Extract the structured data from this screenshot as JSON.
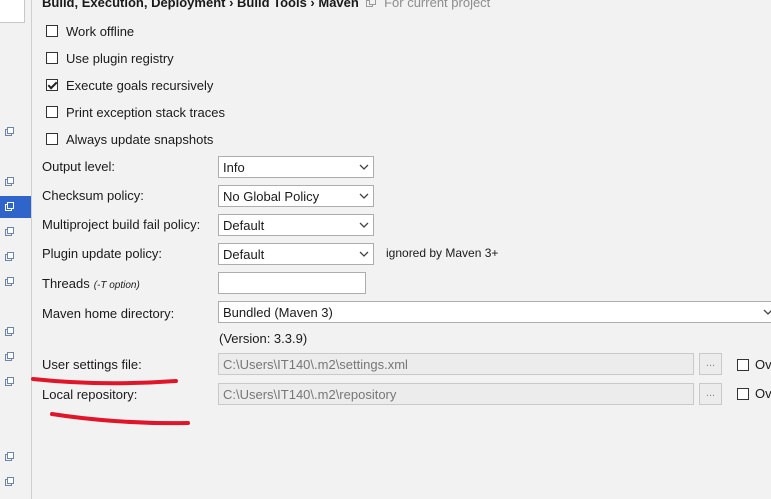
{
  "breadcrumb": {
    "path": "Build, Execution, Deployment › Build Tools › Maven",
    "scope": "For current project"
  },
  "checkboxes": [
    {
      "label": "Work offline",
      "checked": false
    },
    {
      "label": "Use plugin registry",
      "checked": false
    },
    {
      "label": "Execute goals recursively",
      "checked": true
    },
    {
      "label": "Print exception stack traces",
      "checked": false
    },
    {
      "label": "Always update snapshots",
      "checked": false
    }
  ],
  "fields": {
    "output_level": {
      "label": "Output level:",
      "value": "Info"
    },
    "checksum_policy": {
      "label": "Checksum policy:",
      "value": "No Global Policy"
    },
    "multiproject_fail_policy": {
      "label": "Multiproject build fail policy:",
      "value": "Default"
    },
    "plugin_update_policy": {
      "label": "Plugin update policy:",
      "value": "Default",
      "note": "ignored by Maven 3+"
    },
    "threads": {
      "label": "Threads",
      "hint": "(-T option)",
      "value": ""
    },
    "maven_home": {
      "label": "Maven home directory:",
      "value": "Bundled (Maven 3)",
      "version": "(Version: 3.3.9)"
    },
    "user_settings": {
      "label": "User settings file:",
      "value": "C:\\Users\\IT140\\.m2\\settings.xml",
      "browse": "...",
      "override": "Ov"
    },
    "local_repository": {
      "label": "Local repository:",
      "value": "C:\\Users\\IT140\\.m2\\repository",
      "browse": "...",
      "override": "Ov"
    }
  },
  "colors": {
    "background": "#f2f2f2",
    "selection": "#2f65ca",
    "annotation": "#e0152a"
  }
}
